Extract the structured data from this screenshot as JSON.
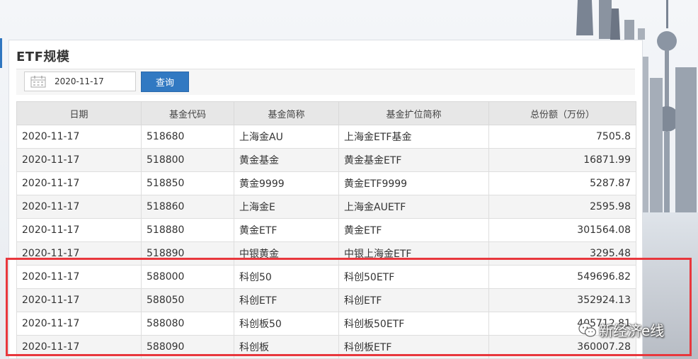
{
  "panel": {
    "title": "ETF规模",
    "date_value": "2020-11-17",
    "query_label": "查询"
  },
  "table": {
    "headers": [
      "日期",
      "基金代码",
      "基金简称",
      "基金扩位简称",
      "总份额（万份）"
    ],
    "rows": [
      [
        "2020-11-17",
        "518680",
        "上海金AU",
        "上海金ETF基金",
        "7505.8"
      ],
      [
        "2020-11-17",
        "518800",
        "黄金基金",
        "黄金基金ETF",
        "16871.99"
      ],
      [
        "2020-11-17",
        "518850",
        "黄金9999",
        "黄金ETF9999",
        "5287.87"
      ],
      [
        "2020-11-17",
        "518860",
        "上海金E",
        "上海金AUETF",
        "2595.98"
      ],
      [
        "2020-11-17",
        "518880",
        "黄金ETF",
        "黄金ETF",
        "301564.08"
      ],
      [
        "2020-11-17",
        "518890",
        "中银黄金",
        "中银上海金ETF",
        "3295.48"
      ],
      [
        "2020-11-17",
        "588000",
        "科创50",
        "科创50ETF",
        "549696.82"
      ],
      [
        "2020-11-17",
        "588050",
        "科创ETF",
        "科创ETF",
        "352924.13"
      ],
      [
        "2020-11-17",
        "588080",
        "科创板50",
        "科创板50ETF",
        "405712.81"
      ],
      [
        "2020-11-17",
        "588090",
        "科创板",
        "科创板ETF",
        "360007.28"
      ]
    ]
  },
  "watermark": {
    "text": "新经济e线"
  },
  "colors": {
    "accent": "#3179c2",
    "highlight": "#e8373d",
    "header_bg": "#e7e7e7"
  },
  "icons": {
    "date": "calendar-icon",
    "watermark": "wechat-icon"
  }
}
